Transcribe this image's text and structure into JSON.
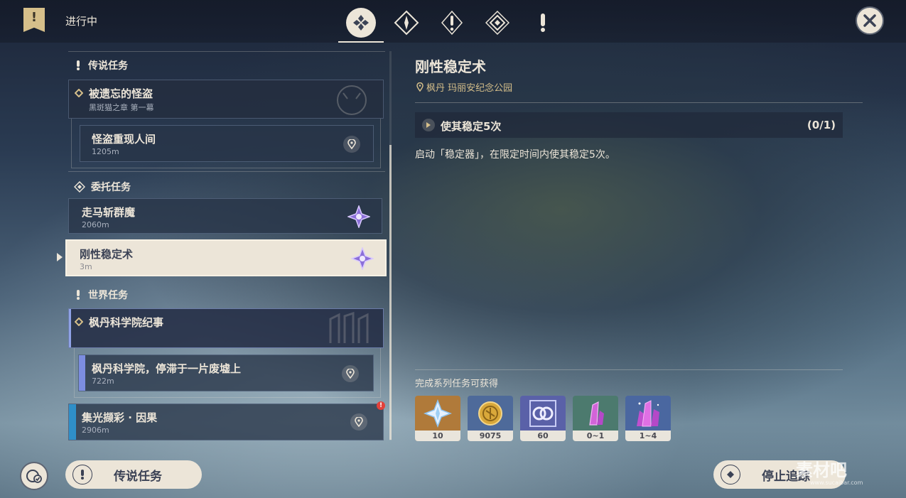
{
  "header": {
    "status": "进行中",
    "tabs": [
      {
        "icon": "all-quests-icon",
        "active": true
      },
      {
        "icon": "archon-quest-icon"
      },
      {
        "icon": "story-quest-icon"
      },
      {
        "icon": "commission-icon"
      },
      {
        "icon": "world-quest-icon"
      }
    ]
  },
  "quest_list": {
    "legend_section": {
      "title": "传说任务"
    },
    "legend_quest": {
      "title": "被遗忘的怪盗",
      "subtitle": "黑斑猫之章 第一幕"
    },
    "legend_step": {
      "title": "怪盗重现人间",
      "distance": "1205m"
    },
    "commission_section": {
      "title": "委托任务"
    },
    "commission_1": {
      "title": "走马斩群魔",
      "distance": "2060m"
    },
    "commission_2": {
      "title": "刚性稳定术",
      "distance": "3m",
      "selected": true
    },
    "world_section": {
      "title": "世界任务"
    },
    "world_quest": {
      "title": "枫丹科学院纪事"
    },
    "world_step": {
      "title": "枫丹科学院，停滞于一片废墟上",
      "distance": "722m"
    },
    "event_quest": {
      "title": "集光撷彩 · 因果",
      "distance": "2906m",
      "alert": "!"
    }
  },
  "detail": {
    "title": "刚性稳定术",
    "location": "枫丹 玛丽安纪念公园",
    "objective": {
      "text": "使其稳定5次",
      "count": "(0/1)"
    },
    "description": "启动「稳定器」，在限定时间内使其稳定5次。",
    "rewards_label": "完成系列任务可获得",
    "rewards": [
      {
        "icon": "primogem-icon",
        "qty": "10",
        "bg": "#b07a3a"
      },
      {
        "icon": "mora-icon",
        "qty": "9075",
        "bg": "#4e6a9a"
      },
      {
        "icon": "adventure-exp-icon",
        "qty": "60",
        "bg": "#5a61a8"
      },
      {
        "icon": "crystal-chunk-icon",
        "qty": "0~1",
        "bg": "#4c7a6e"
      },
      {
        "icon": "crystal-cluster-icon",
        "qty": "1~4",
        "bg": "#4a67a0"
      }
    ]
  },
  "footer": {
    "category_button": "传说任务",
    "stop_tracking_button": "停止追踪"
  },
  "watermark": {
    "text": "素材吧",
    "url": "www.sucaibar.com"
  }
}
